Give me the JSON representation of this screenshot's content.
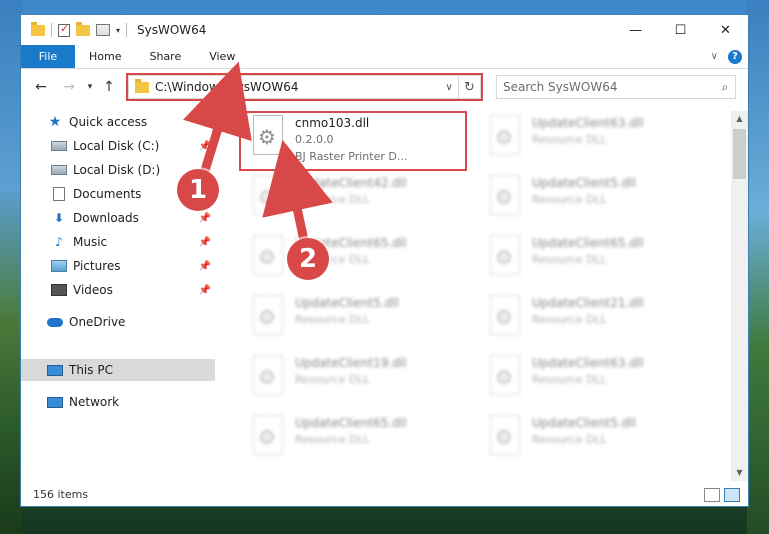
{
  "window": {
    "title": "SysWOW64",
    "controls": {
      "minimize": "—",
      "maximize": "☐",
      "close": "✕"
    }
  },
  "ribbon": {
    "tabs": [
      "File",
      "Home",
      "Share",
      "View"
    ],
    "help": "?"
  },
  "navigation": {
    "address_path": "C:\\Windows\\SysWOW64",
    "search_placeholder": "Search SysWOW64"
  },
  "sidebar": {
    "quick_access": "Quick access",
    "items": [
      {
        "label": "Local Disk (C:)",
        "pinned": true
      },
      {
        "label": "Local Disk (D:)",
        "pinned": false
      },
      {
        "label": "Documents",
        "pinned": true
      },
      {
        "label": "Downloads",
        "pinned": true
      },
      {
        "label": "Music",
        "pinned": true
      },
      {
        "label": "Pictures",
        "pinned": true
      },
      {
        "label": "Videos",
        "pinned": true
      }
    ],
    "onedrive": "OneDrive",
    "this_pc": "This PC",
    "network": "Network"
  },
  "files": [
    {
      "name": "cnmo103.dll",
      "line2": "0.2.0.0",
      "line3": "BJ Raster Printer D...",
      "highlighted": true
    },
    {
      "name": "UpdateClient63.dll",
      "line2": "Resource DLL"
    },
    {
      "name": "UpdateClient42.dll",
      "line2": "Resource DLL"
    },
    {
      "name": "UpdateClient5.dll",
      "line2": "Resource DLL"
    },
    {
      "name": "UpdateClient65.dll",
      "line2": "Resource DLL"
    },
    {
      "name": "UpdateClient65.dll",
      "line2": "Resource DLL"
    },
    {
      "name": "UpdateClient5.dll",
      "line2": "Resource DLL"
    },
    {
      "name": "UpdateClient21.dll",
      "line2": "Resource DLL"
    },
    {
      "name": "UpdateClient19.dll",
      "line2": "Resource DLL"
    },
    {
      "name": "UpdateClient63.dll",
      "line2": "Resource DLL"
    },
    {
      "name": "UpdateClient65.dll",
      "line2": "Resource DLL"
    },
    {
      "name": "UpdateClient5.dll",
      "line2": "Resource DLL"
    }
  ],
  "status": {
    "item_count": "156 items"
  },
  "annotations": {
    "step1": "1",
    "step2": "2",
    "color": "#d84848"
  }
}
